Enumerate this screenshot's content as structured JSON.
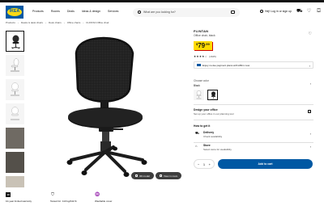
{
  "header": {
    "logo_text": "IKEA",
    "nav": [
      "Products",
      "Rooms",
      "Deals",
      "Ideas & design",
      "Services"
    ],
    "search_placeholder": "What are you looking for?",
    "user_label": "Hej! Log in or sign up",
    "icons": [
      "user-icon",
      "truck-icon",
      "heart-icon",
      "cart-icon"
    ]
  },
  "breadcrumb": [
    "Products",
    "Desks & desk chairs",
    "Desk chairs",
    "Office chairs",
    "FLINTAN Office chair"
  ],
  "product": {
    "name": "FLINTAN",
    "description": "Office chair, black",
    "price_int": "79",
    "price_dec": ".99",
    "price_currency": "$",
    "rating_stars": "★★★★☆",
    "rating_count": "(1625)",
    "promo_text": "Enjoy no-fee payment plans with Affirm now",
    "choose_color_label": "Choose color",
    "color_value": "Black",
    "design_title": "Design your office",
    "design_sub": "Set up your office in our planning tool",
    "howto_label": "How to get it",
    "delivery_title": "Delivery",
    "delivery_sub": "Check availability",
    "store_title": "Store",
    "store_sub": "Select store for availability",
    "qty_minus": "−",
    "qty_value": "1",
    "qty_plus": "+",
    "add_to_cart": "Add to cart"
  },
  "image_buttons": {
    "view_3d": "3D model",
    "view_room": "View in room"
  },
  "footer": {
    "item1": "10-year limited warranty",
    "item2": "Tested for: 110 kg/242 lb",
    "item3": "Washable cover"
  },
  "colors": {
    "brand_blue": "#0058a3",
    "brand_yellow": "#ffdb00",
    "accent_red": "#cc0008"
  }
}
